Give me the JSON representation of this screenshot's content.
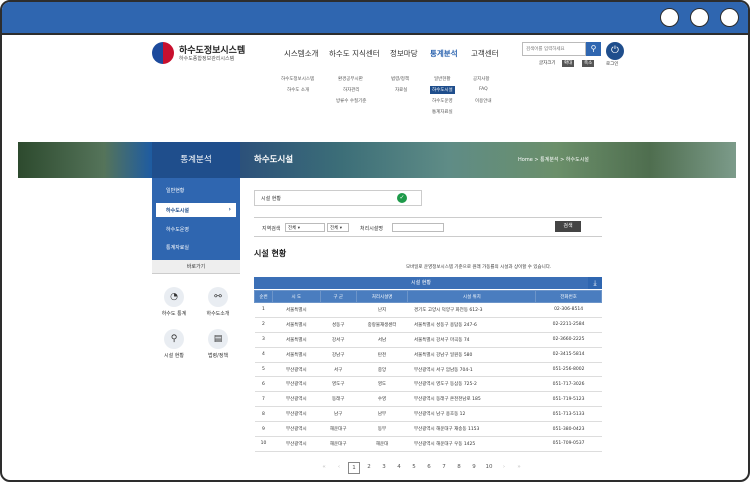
{
  "header": {
    "site_title": "하수도정보시스템",
    "site_subtitle": "하수도종합정보관리시스템",
    "nav": [
      "시스템소개",
      "하수도 지식센터",
      "정보마당",
      "통계분석",
      "고객센터"
    ],
    "search_placeholder": "검색어를 입력하세요",
    "font_label": "글자크기",
    "font_up": "확대",
    "font_down": "축소",
    "logout_label": "로그인"
  },
  "submenu": {
    "col1": [
      "하수도정보시스템",
      "하수도 소개"
    ],
    "col2": [
      "환경공무시판",
      "하자관리",
      "방류수 수질기준"
    ],
    "col3": [
      "법령/정책",
      "자료실"
    ],
    "col4": [
      "일반현황",
      "하수도시설",
      "하수도운영",
      "통계자료실"
    ],
    "col5": [
      "공지사항",
      "FAQ",
      "이용안내"
    ]
  },
  "banner": {
    "section_title": "통계분석",
    "page_title": "하수도시설",
    "breadcrumb": "Home > 통계분석 > 하수도시설"
  },
  "sidebar": {
    "items": [
      "일반현황",
      "하수도시설",
      "하수도운영",
      "통계자료실"
    ],
    "active_index": 1,
    "quick_title": "바로가기",
    "quick_links": [
      {
        "label": "하수도 통계",
        "icon": "chart-icon"
      },
      {
        "label": "하수도소개",
        "icon": "share-icon"
      },
      {
        "label": "시설 현황",
        "icon": "search-icon"
      },
      {
        "label": "법령/정책",
        "icon": "document-icon"
      }
    ]
  },
  "filter": {
    "status_label": "시설 현황",
    "region_label": "지역검색",
    "select1": "전체",
    "select2": "전체",
    "name_label": "처리시설명",
    "search_button": "검색"
  },
  "section": {
    "title": "시설 현황",
    "note": "모바일로 운영정보시스템 기준으로 원래 가동률의 시설과 상이할 수 있습니다.",
    "table_caption": "시설 현황"
  },
  "table": {
    "headers": [
      "순번",
      "시 도",
      "구 군",
      "처리시설명",
      "시설 위치",
      "전화번호"
    ],
    "rows": [
      [
        "1",
        "서울특별시",
        "",
        "난지",
        "경기도 고양시 덕양구 화전동 612-3",
        "02-306-8514"
      ],
      [
        "2",
        "서울특별시",
        "성동구",
        "중랑물재생센터",
        "서울특별시 성동구 용답동 247-6",
        "02-2211-2584"
      ],
      [
        "3",
        "서울특별시",
        "강서구",
        "서남",
        "서울특별시 강서구 마곡동 74",
        "02-3660-2225"
      ],
      [
        "4",
        "서울특별시",
        "강남구",
        "탄천",
        "서울특별시 강남구 일원동 580",
        "02-3415-5814"
      ],
      [
        "5",
        "부산광역시",
        "서구",
        "중앙",
        "부산광역시 서구 암남동 704-1",
        "051-256-8002"
      ],
      [
        "6",
        "부산광역시",
        "영도구",
        "영도",
        "부산광역시 영도구 동삼동 725-2",
        "051-717-3026"
      ],
      [
        "7",
        "부산광역시",
        "동래구",
        "수영",
        "부산광역시 동래구 온천천남로 185",
        "051-719-5123"
      ],
      [
        "8",
        "부산광역시",
        "남구",
        "남부",
        "부산광역시 남구 용호동 12",
        "051-713-5133"
      ],
      [
        "9",
        "부산광역시",
        "해운대구",
        "동부",
        "부산광역시 해운대구 재송동 1153",
        "051-380-0423"
      ],
      [
        "10",
        "부산광역시",
        "해운대구",
        "해운대",
        "부산광역시 해운대구 우동 1425",
        "051-709-0537"
      ]
    ]
  },
  "pagination": {
    "prev_first": "«",
    "prev": "‹",
    "pages": [
      "1",
      "2",
      "3",
      "4",
      "5",
      "6",
      "7",
      "8",
      "9",
      "10"
    ],
    "current": "1",
    "next": "›",
    "next_last": "»"
  }
}
